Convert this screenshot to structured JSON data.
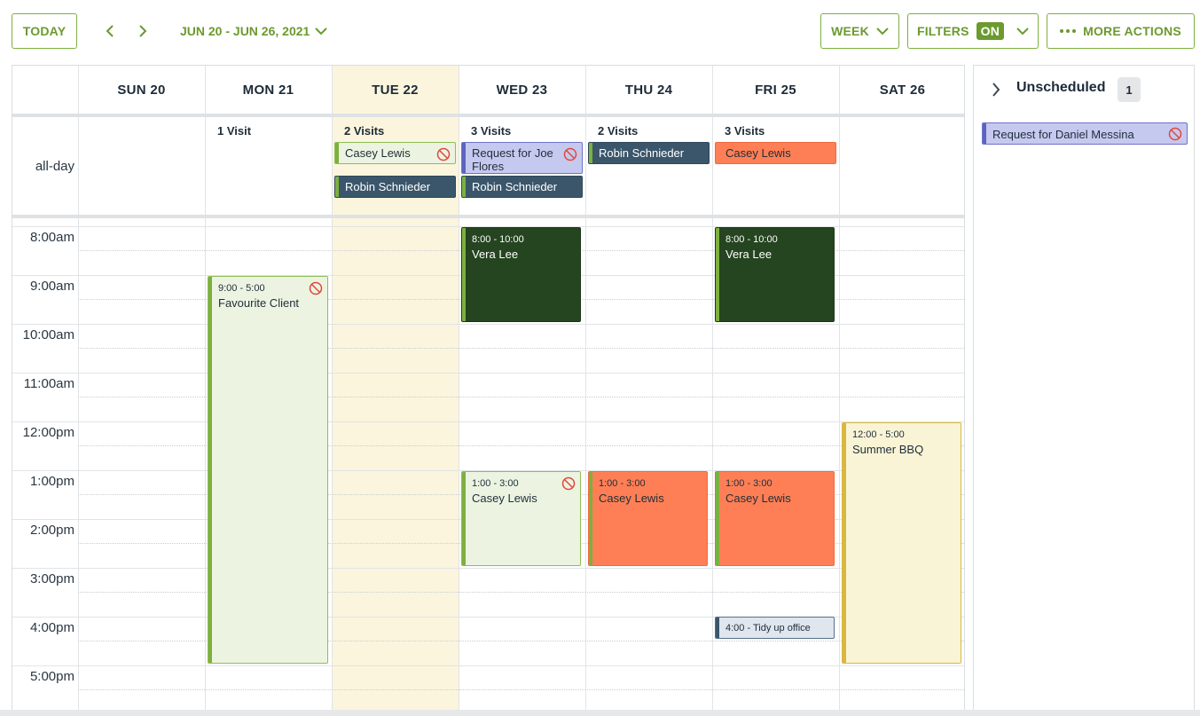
{
  "toolbar": {
    "today_label": "TODAY",
    "date_range": "JUN 20 - JUN 26, 2021",
    "view_label": "WEEK",
    "filters_label": "FILTERS",
    "filters_state": "ON",
    "more_actions_label": "MORE ACTIONS"
  },
  "days": [
    {
      "label": "SUN 20",
      "visits": ""
    },
    {
      "label": "MON 21",
      "visits": "1 Visit"
    },
    {
      "label": "TUE 22",
      "visits": "2 Visits"
    },
    {
      "label": "WED 23",
      "visits": "3 Visits"
    },
    {
      "label": "THU 24",
      "visits": "2 Visits"
    },
    {
      "label": "FRI 25",
      "visits": "3 Visits"
    },
    {
      "label": "SAT 26",
      "visits": ""
    }
  ],
  "allday_label": "all-day",
  "times": [
    "8:00am",
    "9:00am",
    "10:00am",
    "11:00am",
    "12:00pm",
    "1:00pm",
    "2:00pm",
    "3:00pm",
    "4:00pm",
    "5:00pm"
  ],
  "allday_events": {
    "tue_casey": "Casey Lewis",
    "tue_robin": "Robin Schnieder",
    "wed_request": "Request for Joe Flores",
    "wed_robin": "Robin Schnieder",
    "thu_robin": "Robin Schnieder",
    "fri_casey": "Casey Lewis"
  },
  "events": {
    "mon_fav": {
      "time": "9:00 - 5:00",
      "title": "Favourite Client"
    },
    "wed_vera": {
      "time": "8:00 - 10:00",
      "title": "Vera Lee"
    },
    "fri_vera": {
      "time": "8:00 - 10:00",
      "title": "Vera Lee"
    },
    "wed_casey": {
      "time": "1:00 - 3:00",
      "title": "Casey Lewis"
    },
    "thu_casey": {
      "time": "1:00 - 3:00",
      "title": "Casey Lewis"
    },
    "fri_casey": {
      "time": "1:00 - 3:00",
      "title": "Casey Lewis"
    },
    "fri_tidy": {
      "title": "4:00 - Tidy up office"
    },
    "sat_bbq": {
      "time": "12:00 - 5:00",
      "title": "Summer BBQ"
    }
  },
  "sidebar": {
    "title": "Unscheduled",
    "count": "1",
    "items": [
      "Request for Daniel Messina"
    ]
  },
  "colors": {
    "brand_green": "#7db040",
    "today_column": "#faf5dc",
    "dark_green": "#254420",
    "orange": "#fe7f55",
    "slate": "#3b566b",
    "lavender": "#c6c9ef",
    "yellow": "#f9f4d5"
  }
}
